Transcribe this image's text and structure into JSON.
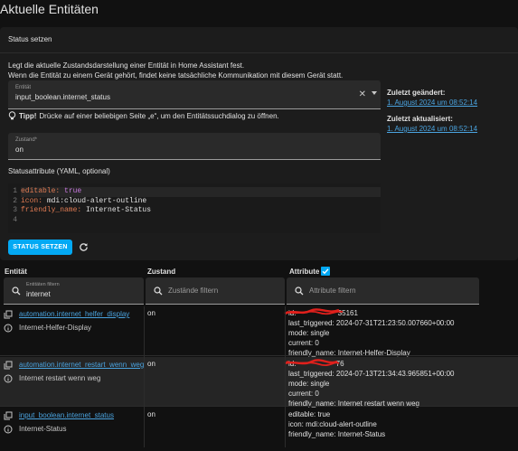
{
  "page": {
    "title": "Aktuelle Entitäten"
  },
  "set_state": {
    "title": "Status setzen",
    "description_line1": "Legt die aktuelle Zustandsdarstellung einer Entität in Home Assistant fest.",
    "description_line2": "Wenn die Entität zu einem Gerät gehört, findet keine tatsächliche Kommunikation mit diesem Gerät statt.",
    "entity_label": "Entität",
    "entity_value": "input_boolean.internet_status",
    "tip_strong": "Tipp!",
    "tip_text": "Drücke auf einer beliebigen Seite „e“, um den Entitätssuchdialog zu öffnen.",
    "state_label": "Zustand*",
    "state_value": "on",
    "last_changed_label": "Zuletzt geändert:",
    "last_changed_value": "1. August 2024 um 08:52:14",
    "last_updated_label": "Zuletzt aktualisiert:",
    "last_updated_value": "1. August 2024 um 08:52:14",
    "yaml_label": "Statusattribute (YAML, optional)",
    "yaml_lines": [
      {
        "num": "1",
        "key": "editable:",
        "value": " true"
      },
      {
        "num": "2",
        "key": "icon:",
        "value": " mdi:cloud-alert-outline"
      },
      {
        "num": "3",
        "key": "friendly_name:",
        "value": " Internet-Status"
      },
      {
        "num": "4",
        "key": "",
        "value": ""
      }
    ],
    "button_label": "STATUS SETZEN"
  },
  "table": {
    "col_entity": "Entität",
    "col_state": "Zustand",
    "col_attributes": "Attribute",
    "filter_entity_label": "Entitäten filtern",
    "filter_entity_value": "internet",
    "filter_state_placeholder": "Zustände filtern",
    "filter_attr_placeholder": "Attribute filtern",
    "rows": [
      {
        "entity_id": "automation.internet_helfer_display",
        "name": "Internet-Helfer-Display",
        "state": "on",
        "id_fragment": "id: ",
        "id_tail": "35161",
        "attrs": [
          "last_triggered: 2024-07-31T21:23:50.007660+00:00",
          "mode: single",
          "current: 0",
          "friendly_name: Internet-Helfer-Display"
        ]
      },
      {
        "entity_id": "automation.internet_restart_wenn_weg",
        "name": "Internet restart wenn weg",
        "state": "on",
        "id_fragment": "id: ",
        "id_tail": "76",
        "attrs": [
          "last_triggered: 2024-07-13T21:34:43.965851+00:00",
          "mode: single",
          "current: 0",
          "friendly_name: Internet restart wenn weg"
        ]
      },
      {
        "entity_id": "input_boolean.internet_status",
        "name": "Internet-Status",
        "state": "on",
        "attrs": [
          "editable: true",
          "icon: mdi:cloud-alert-outline",
          "friendly_name: Internet-Status"
        ]
      }
    ]
  },
  "colors": {
    "accent": "#03a9f4",
    "link": "#4aa3df",
    "background": "#111111",
    "card": "#1c1c1c",
    "redaction": "#e0201c"
  }
}
